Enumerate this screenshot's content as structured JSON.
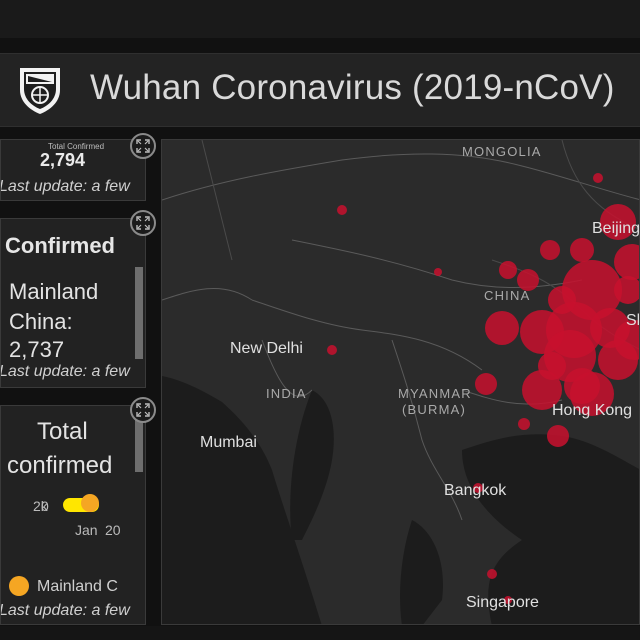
{
  "header": {
    "title": "Wuhan Coronavirus (2019-nCoV)",
    "logo_icon": "university-shield-icon"
  },
  "panels": {
    "total": {
      "label": "Total Confirmed",
      "value": "2,794",
      "last_update": "Last update: a few"
    },
    "confirmed_list": {
      "title": "Confirmed",
      "region_line1": "Mainland",
      "region_line2": "China:",
      "region_value": "2,737",
      "last_update": "Last update: a few"
    },
    "chart": {
      "title_line1": "Total",
      "title_line2": "confirmed",
      "axis_value_a": "2k",
      "axis_value_b": "0",
      "axis_date_a": "Jan",
      "axis_date_b": "20",
      "legend_label": "Mainland C",
      "legend_color": "#f5a623",
      "last_update": "Last update: a few"
    }
  },
  "map": {
    "country_labels": [
      "MONGOLIA",
      "CHINA",
      "INDIA",
      "MYANMAR",
      "(BURMA)"
    ],
    "city_labels": [
      "Beijing",
      "Sh",
      "New Delhi",
      "Mumbai",
      "Hong Kong",
      "Bangkok",
      "Singapore"
    ],
    "marker_color": "#c8102e",
    "background_color": "#2b2b2b"
  },
  "colors": {
    "page_background": "#111111",
    "panel_background": "#222222",
    "accent_yellow": "#ffe600"
  }
}
